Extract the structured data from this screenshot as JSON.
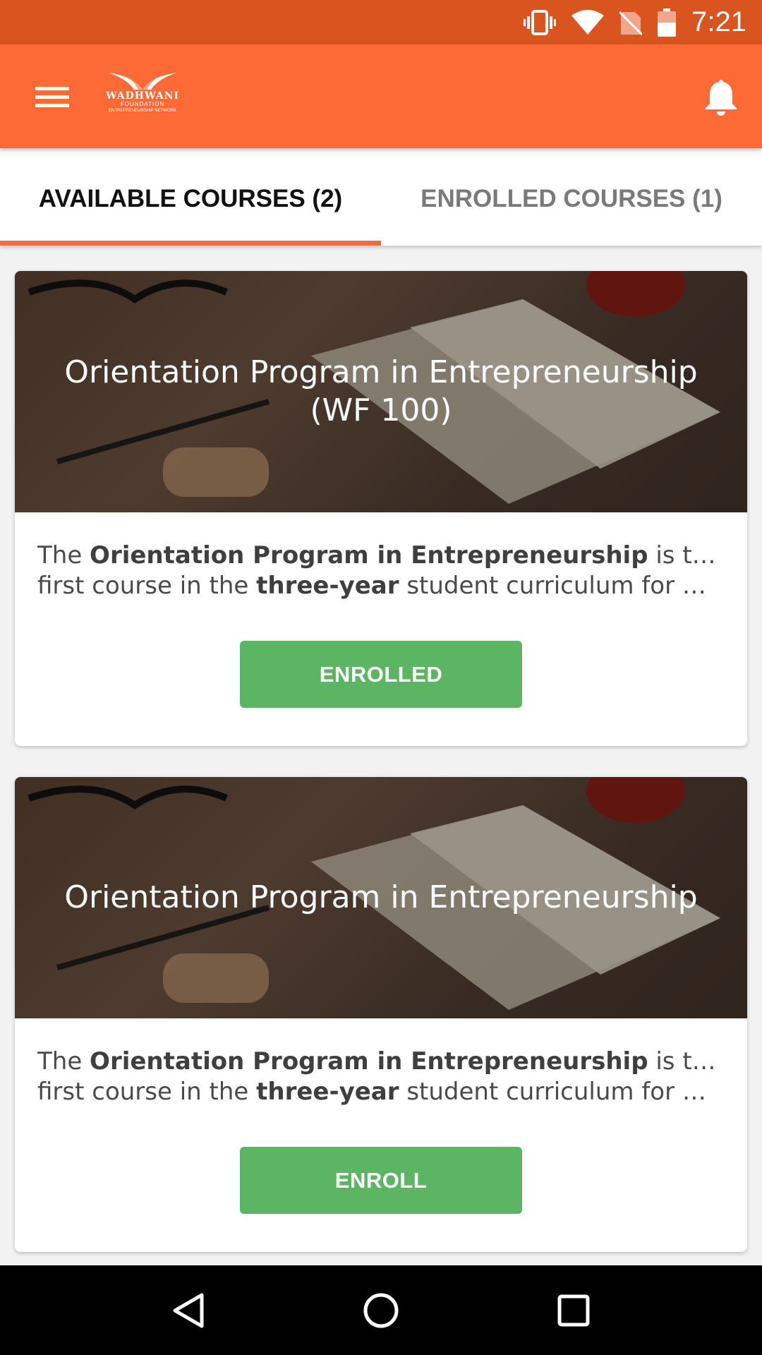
{
  "status_bar": {
    "time": "7:21",
    "icons": [
      "vibrate-icon",
      "wifi-icon",
      "no-sim-icon",
      "battery-icon"
    ]
  },
  "app_bar": {
    "menu_icon": "hamburger-menu-icon",
    "logo": {
      "name": "WADHWANI",
      "sub": "FOUNDATION",
      "network": "ENTREPRENEURSHIP NETWORK"
    },
    "notification_icon": "bell-icon",
    "background_color": "#fe6a35"
  },
  "tabs": [
    {
      "label": "AVAILABLE COURSES (2)",
      "active": true
    },
    {
      "label": "ENROLLED COURSES (1)",
      "active": false
    }
  ],
  "courses": [
    {
      "title": "Orientation Program in Entrepreneurship (WF 100)",
      "desc_line1_pre": "The ",
      "desc_line1_bold": "Orientation Program in Entrepreneurship",
      "desc_line1_post": " is the",
      "desc_line2_pre": "first course in the ",
      "desc_line2_bold": "three-year",
      "desc_line2_post": " student curriculum for entre…",
      "button_label": "ENROLLED"
    },
    {
      "title": "Orientation Program in Entrepreneurship",
      "desc_line1_pre": "The ",
      "desc_line1_bold": "Orientation Program in Entrepreneurship",
      "desc_line1_post": " is the",
      "desc_line2_pre": "first course in the ",
      "desc_line2_bold": "three-year",
      "desc_line2_post": " student curriculum for entre…",
      "button_label": "ENROLL"
    }
  ],
  "colors": {
    "accent": "#fe6a35",
    "status_bar": "#d9541f",
    "button_green": "#5cb562"
  },
  "nav_bar": {
    "icons": [
      "back-icon",
      "home-icon",
      "recents-icon"
    ]
  }
}
